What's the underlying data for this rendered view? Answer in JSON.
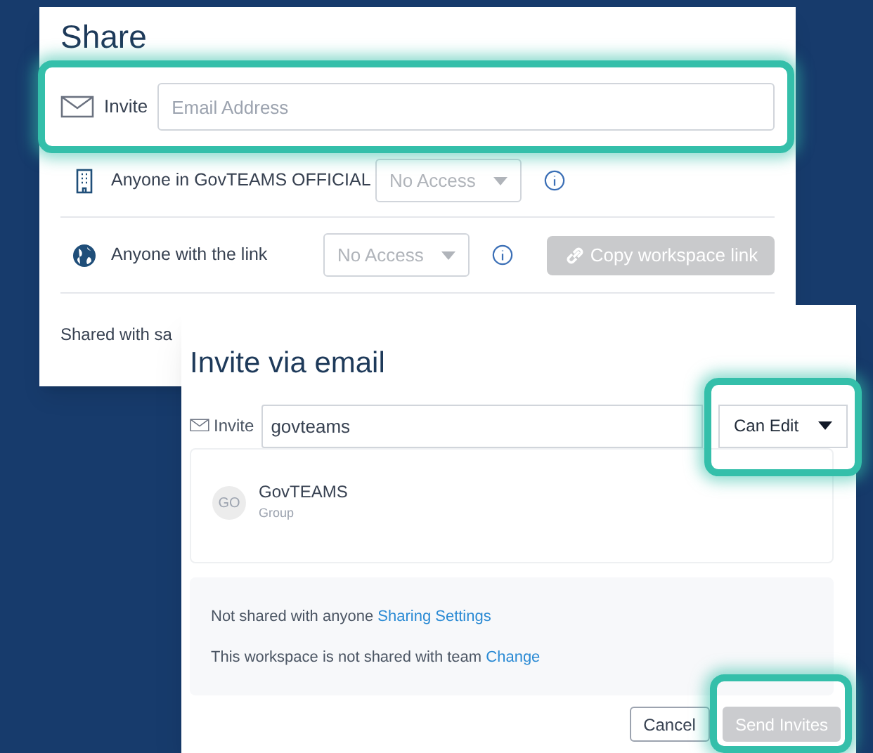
{
  "share": {
    "title": "Share",
    "invite": {
      "label": "Invite",
      "placeholder": "Email Address",
      "highlighted": true
    },
    "rows": [
      {
        "kind": "org",
        "label": "Anyone in GovTEAMS OFFICIAL",
        "access": "No Access"
      },
      {
        "kind": "link",
        "label": "Anyone with the link",
        "access": "No Access",
        "button": "Copy workspace link"
      }
    ],
    "shared_with": "Shared with sa"
  },
  "invite_dialog": {
    "title": "Invite via email",
    "invite": {
      "label": "Invite",
      "value": "govteams",
      "permission": "Can Edit",
      "permission_highlighted": true
    },
    "results": [
      {
        "initials": "GO",
        "name": "GovTEAMS",
        "type": "Group"
      }
    ],
    "notes": [
      {
        "text": "Not shared with anyone",
        "link": "Sharing Settings"
      },
      {
        "text": "This workspace is not shared with team",
        "link": "Change"
      }
    ],
    "buttons": [
      {
        "label": "Cancel",
        "kind": "secondary",
        "disabled": false,
        "highlighted": false
      },
      {
        "label": "Send Invites",
        "kind": "primary",
        "disabled": true,
        "highlighted": true
      }
    ]
  }
}
